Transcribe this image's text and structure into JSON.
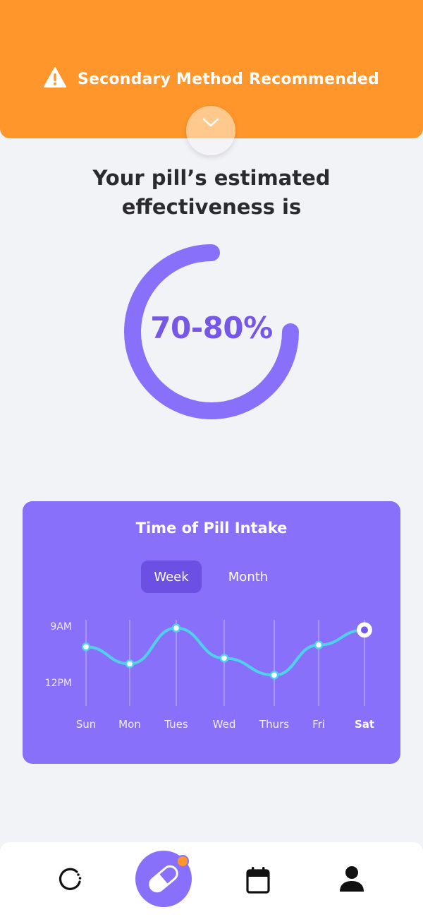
{
  "banner": {
    "text": "Secondary Method Recommended",
    "icon": "warning-icon",
    "color": "#fe962b"
  },
  "toggle": {
    "icon": "chevron-down-icon"
  },
  "headline": {
    "line1": "Your pill’s estimated",
    "line2": "effectiveness is"
  },
  "effectiveness": {
    "value_label": "70-80%",
    "ring_fill_fraction": 0.75,
    "color": "#7657e7"
  },
  "intake_card": {
    "title": "Time of Pill Intake",
    "tabs": [
      {
        "label": "Week",
        "active": true
      },
      {
        "label": "Month",
        "active": false
      }
    ],
    "background": "#8870fb",
    "line_color": "#4fd1ea"
  },
  "chart_data": {
    "type": "line",
    "title": "Time of Pill Intake",
    "categories": [
      "Sun",
      "Mon",
      "Tues",
      "Wed",
      "Thurs",
      "Fri",
      "Sat"
    ],
    "y_tick_labels": [
      "9AM",
      "12PM"
    ],
    "y_axis": "time of day (hours after midnight, later = lower)",
    "ylim": [
      8.5,
      12.5
    ],
    "series": [
      {
        "values": [
          10.1,
          11.0,
          9.1,
          10.7,
          11.6,
          10.0,
          9.2
        ]
      }
    ],
    "highlighted_category": "Sat",
    "grid": "vertical"
  },
  "nav": {
    "items": [
      {
        "name": "cycle",
        "icon": "cycle-icon",
        "active": false
      },
      {
        "name": "pill",
        "icon": "pill-icon",
        "active": true,
        "badge": true
      },
      {
        "name": "calendar",
        "icon": "calendar-icon",
        "active": false
      },
      {
        "name": "profile",
        "icon": "user-icon",
        "active": false
      }
    ]
  }
}
